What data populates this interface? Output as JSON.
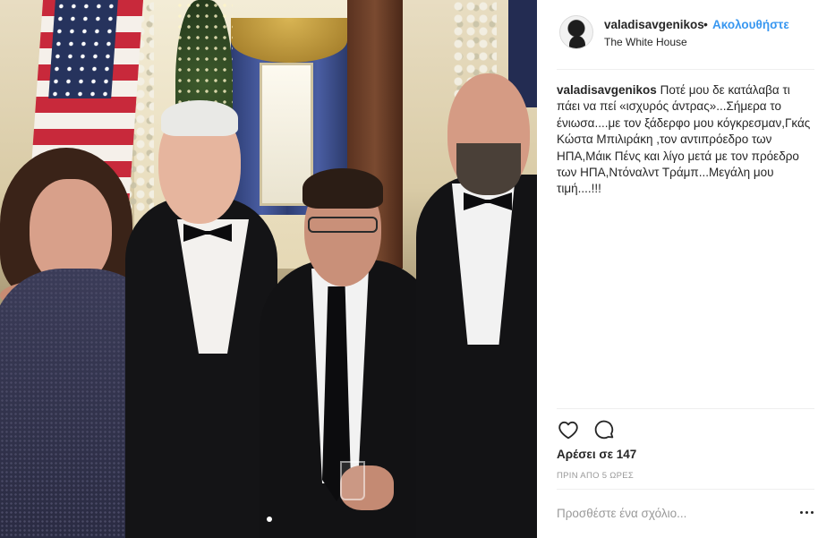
{
  "post": {
    "author": {
      "username": "valadisavgenikos",
      "separator": "•",
      "follow_label": "Ακολουθήστε",
      "location": "The White House"
    },
    "caption": {
      "username": "valadisavgenikos",
      "text": "Ποτέ μου δε κατάλαβα τι πάει να πεί «ισχυρός άντρας»...Σήμερα το ένιωσα....με τον ξάδερφο μου κόγκρεσμαν,Γκάς Κώστα Μπιλιράκη ,τον αντιπρόεδρο των ΗΠΑ,Μάικ Πένς και λίγο μετά με τον πρόεδρο των ΗΠΑ,Ντόναλντ Τράμπ...Μεγάλη μου τιμή....!!!"
    },
    "likes_label": "Αρέσει σε 147",
    "time_ago": "ΠΡΙΝ ΑΠΟ 5 ΩΡΕΣ",
    "comment_placeholder": "Προσθέστε ένα σχόλιο...",
    "photo": {
      "carousel_dots": 1
    }
  },
  "colors": {
    "text": "#262626",
    "link": "#3897f0",
    "muted": "#999999",
    "divider": "#efefef"
  },
  "icons": {
    "like": "heart-icon",
    "comment": "speech-bubble-icon",
    "more": "ellipsis-icon"
  }
}
